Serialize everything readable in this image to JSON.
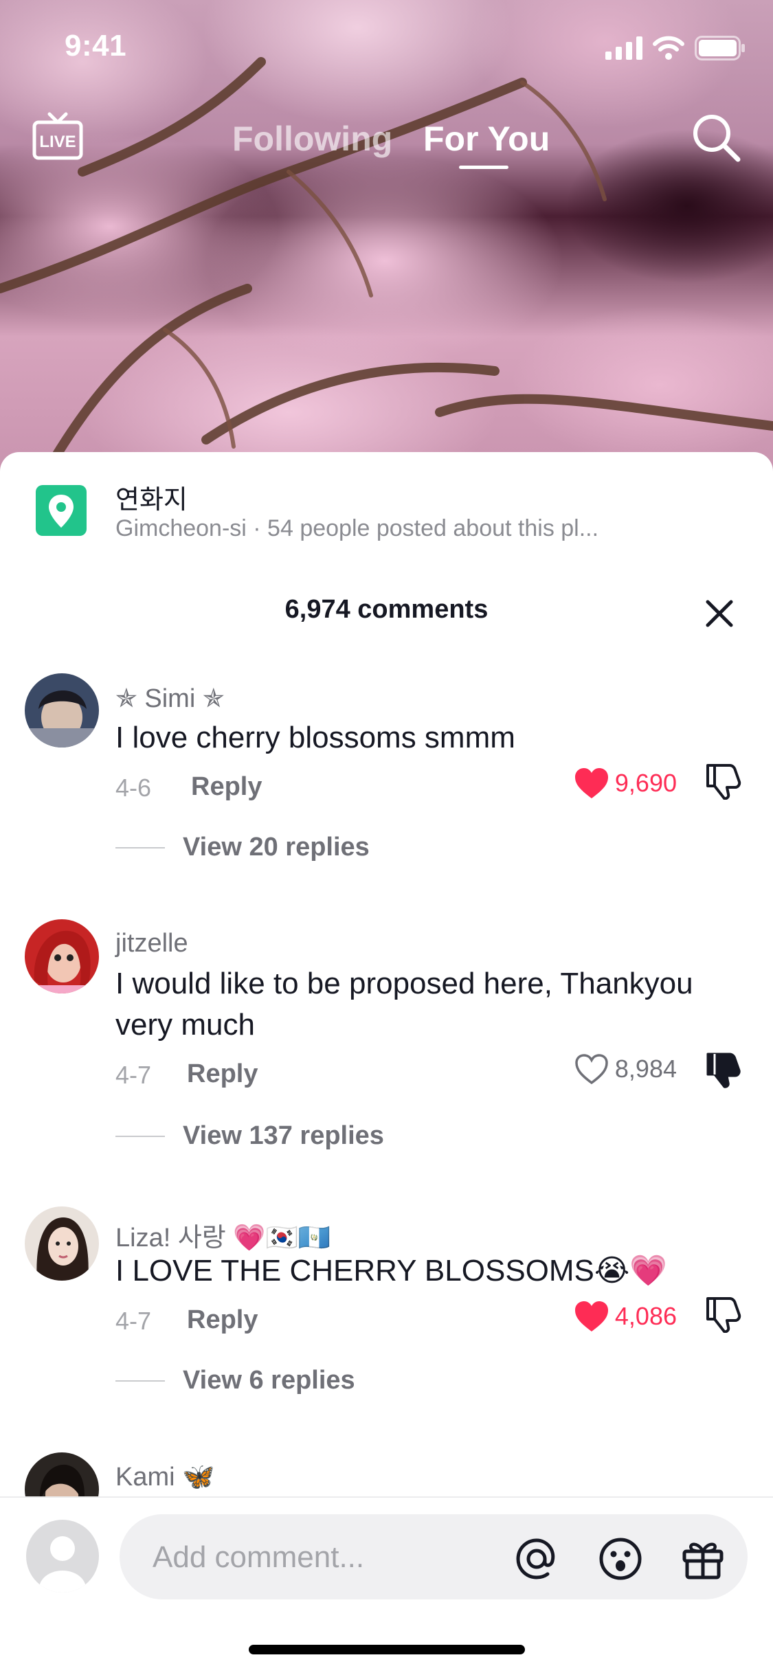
{
  "status_bar": {
    "time": "9:41"
  },
  "top_nav": {
    "live_label": "LIVE",
    "tabs": [
      {
        "label": "Following",
        "active": false
      },
      {
        "label": "For You",
        "active": true
      }
    ]
  },
  "place": {
    "name": "연화지",
    "subtitle": "Gimcheon-si · 54 people posted about this pl..."
  },
  "comments_header": {
    "count_label": "6,974 comments"
  },
  "comments": [
    {
      "username": "✯ Simi ✯",
      "text": "I love cherry blossoms smmm",
      "date": "4-6",
      "reply_label": "Reply",
      "likes": "9,690",
      "liked": true,
      "disliked": false,
      "view_replies": "View 20 replies"
    },
    {
      "username": "jitzelle",
      "text": "I would like to be proposed here, Thankyou very much",
      "date": "4-7",
      "reply_label": "Reply",
      "likes": "8,984",
      "liked": false,
      "disliked": true,
      "view_replies": "View 137 replies"
    },
    {
      "username": "Liza! 사랑 💗🇰🇷🇬🇹",
      "text": "I LOVE THE CHERRY BLOSSOMS😭💗",
      "date": "4-7",
      "reply_label": "Reply",
      "likes": "4,086",
      "liked": true,
      "disliked": false,
      "view_replies": "View 6 replies"
    },
    {
      "username": "Kami 🦋"
    }
  ],
  "composer": {
    "placeholder": "Add comment..."
  },
  "icons": {
    "live": "live-tv-icon",
    "search": "search-icon",
    "location": "location-pin-icon",
    "close": "close-icon",
    "like": "heart-icon",
    "dislike": "thumbs-down-icon",
    "mention": "at-sign-icon",
    "emoji": "emoji-icon",
    "gift": "gift-icon"
  },
  "colors": {
    "like_active": "#fe2c55",
    "place_icon": "#22c48b",
    "text_primary": "#161823",
    "text_secondary": "#6f7077"
  }
}
